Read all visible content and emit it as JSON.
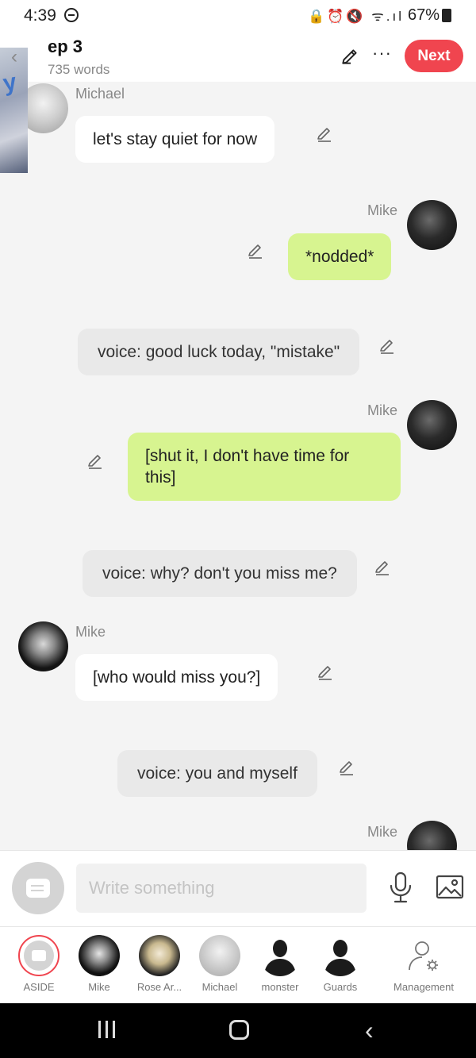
{
  "status_bar": {
    "time": "4:39",
    "icons": "🔒⏰🔇 ᯤ.ıl",
    "battery": "67%"
  },
  "header": {
    "title": "ep 3",
    "subtitle": "735 words",
    "next_label": "Next",
    "more_label": "···",
    "cover_text": "y"
  },
  "messages": [
    {
      "type": "left",
      "name": "Michael",
      "text": "let's stay quiet for now"
    },
    {
      "type": "right",
      "name": "Mike",
      "text": "*nodded*"
    },
    {
      "type": "voice",
      "text": "voice: good luck today, \"mistake\""
    },
    {
      "type": "right",
      "name": "Mike",
      "text": "[shut it, I don't have time for this]"
    },
    {
      "type": "voice",
      "text": "voice: why? don't you miss me?"
    },
    {
      "type": "left",
      "name": "Mike",
      "text": "[who would miss you?]"
    },
    {
      "type": "voice",
      "text": "voice: you and myself"
    },
    {
      "type": "right",
      "name": "Mike",
      "text": ""
    }
  ],
  "composer": {
    "placeholder": "Write something"
  },
  "characters": [
    {
      "label": "ASIDE"
    },
    {
      "label": "Mike"
    },
    {
      "label": "Rose Ar..."
    },
    {
      "label": "Michael"
    },
    {
      "label": "monster"
    },
    {
      "label": "Guards"
    },
    {
      "label": "Management"
    }
  ],
  "colors": {
    "accent": "#f0454f",
    "green_bubble": "#d7f490",
    "white_bubble": "#ffffff",
    "voice_bubble": "#e9e9e9"
  }
}
